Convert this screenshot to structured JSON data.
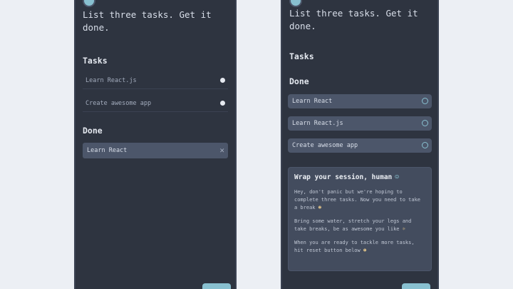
{
  "left": {
    "heading": "List three tasks. Get it done.",
    "tasks_label": "Tasks",
    "tasks": [
      "Learn React.js",
      "Create awesome app"
    ],
    "done_label": "Done",
    "done": [
      "Learn React"
    ]
  },
  "right": {
    "heading": "List three tasks. Get it done.",
    "tasks_label": "Tasks",
    "done_label": "Done",
    "done": [
      "Learn React",
      "Learn React.js",
      "Create awesome app"
    ],
    "card": {
      "title": "Wrap your session, human",
      "p1": "Hey, don't panic but we're hoping to complete three tasks. Now you need to take a break",
      "p2": "Bring some water, stretch your legs and take breaks, be as awesome you like",
      "p3": "When you are ready to tackle more tasks, hit reset button below"
    }
  }
}
